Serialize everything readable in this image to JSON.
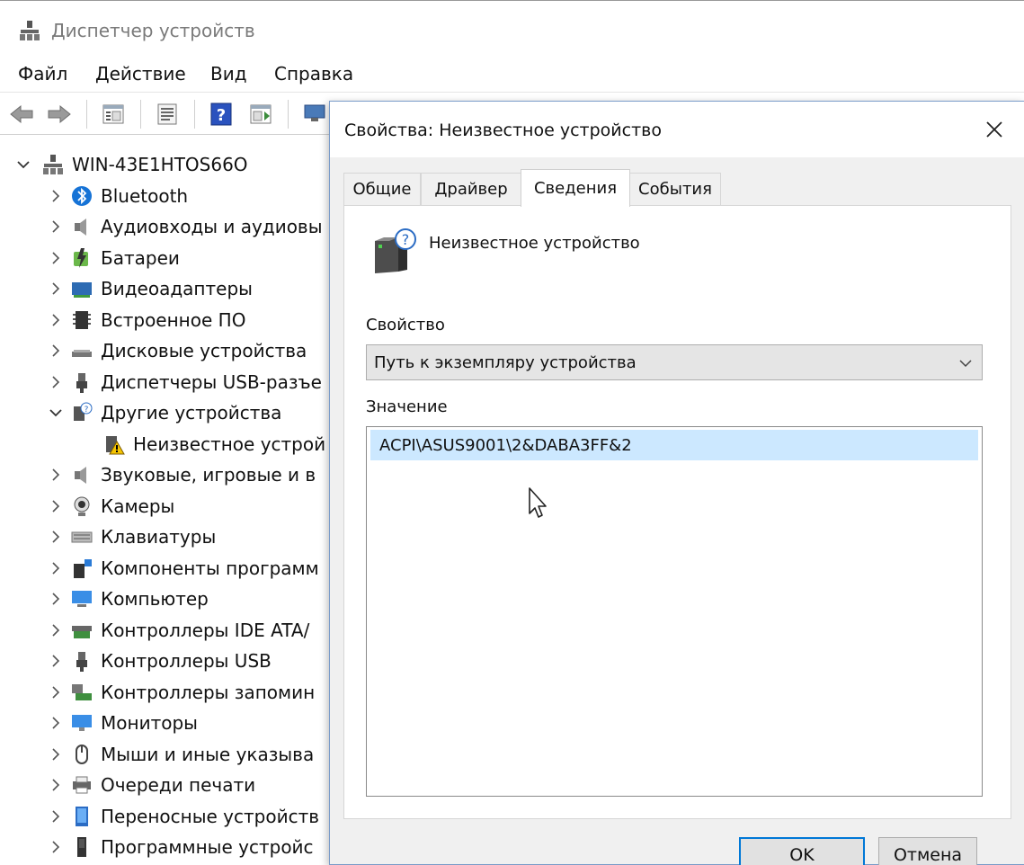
{
  "window": {
    "title": "Диспетчер устройств",
    "menu": [
      "Файл",
      "Действие",
      "Вид",
      "Справка"
    ],
    "toolbar_icons": [
      "back-arrow-icon",
      "forward-arrow-icon",
      "show-hide-console-tree-icon",
      "properties-icon",
      "help-icon",
      "action-pane-icon",
      "scan-hardware-icon"
    ]
  },
  "tree": {
    "root": "WIN-43E1HTOS66O",
    "items": [
      {
        "label": "Bluetooth",
        "icon": "bluetooth-icon",
        "expanded": false
      },
      {
        "label": "Аудиовходы и аудиовы",
        "icon": "speaker-icon",
        "expanded": false
      },
      {
        "label": "Батареи",
        "icon": "battery-icon",
        "expanded": false
      },
      {
        "label": "Видеоадаптеры",
        "icon": "display-adapter-icon",
        "expanded": false
      },
      {
        "label": "Встроенное ПО",
        "icon": "firmware-icon",
        "expanded": false
      },
      {
        "label": "Дисковые устройства",
        "icon": "disk-icon",
        "expanded": false
      },
      {
        "label": "Диспетчеры USB-разъе",
        "icon": "usb-icon",
        "expanded": false
      },
      {
        "label": "Другие устройства",
        "icon": "unknown-device-icon",
        "expanded": true
      },
      {
        "label": "Неизвестное устрой",
        "icon": "warning-device-icon",
        "child": true
      },
      {
        "label": "Звуковые, игровые и в",
        "icon": "speaker-icon",
        "expanded": false
      },
      {
        "label": "Камеры",
        "icon": "camera-icon",
        "expanded": false
      },
      {
        "label": "Клавиатуры",
        "icon": "keyboard-icon",
        "expanded": false
      },
      {
        "label": "Компоненты программ",
        "icon": "software-component-icon",
        "expanded": false
      },
      {
        "label": "Компьютер",
        "icon": "computer-icon",
        "expanded": false
      },
      {
        "label": "Контроллеры IDE ATA/",
        "icon": "ide-controller-icon",
        "expanded": false
      },
      {
        "label": "Контроллеры USB",
        "icon": "usb-icon",
        "expanded": false
      },
      {
        "label": "Контроллеры запомин",
        "icon": "storage-controller-icon",
        "expanded": false
      },
      {
        "label": "Мониторы",
        "icon": "monitor-icon",
        "expanded": false
      },
      {
        "label": "Мыши и иные указыва",
        "icon": "mouse-icon",
        "expanded": false
      },
      {
        "label": "Очереди печати",
        "icon": "printer-icon",
        "expanded": false
      },
      {
        "label": "Переносные устройств",
        "icon": "portable-device-icon",
        "expanded": false
      },
      {
        "label": "Программные устройс",
        "icon": "software-device-icon",
        "expanded": false
      }
    ]
  },
  "dialog": {
    "title": "Свойства: Неизвестное устройство",
    "tabs": [
      "Общие",
      "Драйвер",
      "Сведения",
      "События"
    ],
    "active_tab": "Сведения",
    "device_name": "Неизвестное устройство",
    "property_label": "Свойство",
    "property_value": "Путь к экземпляру устройства",
    "value_label": "Значение",
    "value_items": [
      "ACPI\\ASUS9001\\2&DABA3FF&2"
    ],
    "ok_label": "OK",
    "cancel_label": "Отмена"
  }
}
